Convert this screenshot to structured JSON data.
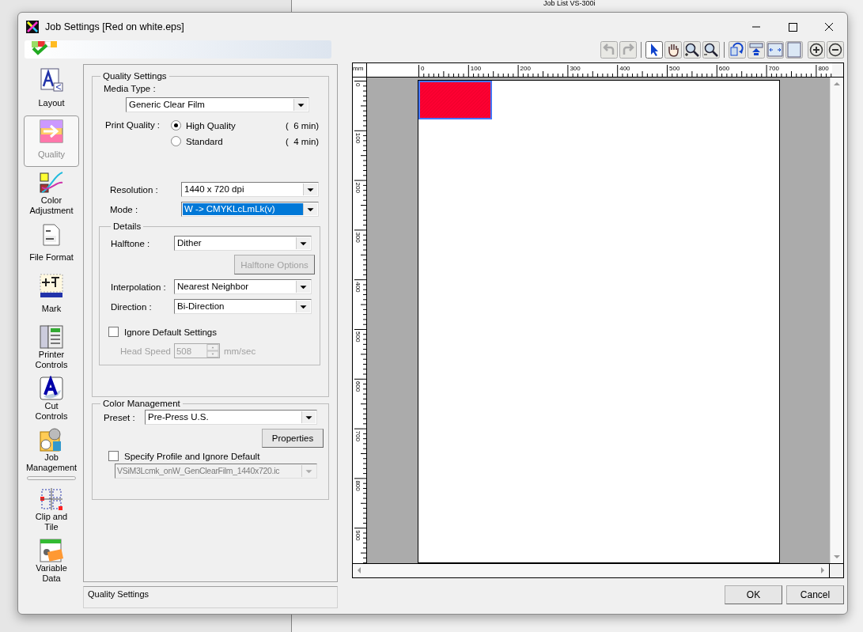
{
  "background": {
    "title": "Job List VS-300i"
  },
  "window": {
    "title": "Job Settings [Red on white.eps]"
  },
  "sidebar": {
    "items": [
      {
        "label": "Layout",
        "selected": false
      },
      {
        "label": "Quality",
        "selected": true
      },
      {
        "label": "Color Adjustment",
        "selected": false
      },
      {
        "label": "File Format",
        "selected": false
      },
      {
        "label": "Mark",
        "selected": false
      },
      {
        "label": "Printer Controls",
        "selected": false
      },
      {
        "label": "Cut Controls",
        "selected": false
      },
      {
        "label": "Job Management",
        "selected": false
      },
      {
        "label": "Clip and Tile",
        "selected": false
      },
      {
        "label": "Variable Data",
        "selected": false
      }
    ]
  },
  "quality_settings": {
    "title": "Quality Settings",
    "media_type": {
      "label": "Media Type :",
      "value": "Generic Clear Film"
    },
    "print_quality": {
      "label": "Print Quality :",
      "options": [
        {
          "label": "High Quality",
          "time": "(  6 min)",
          "selected": true
        },
        {
          "label": "Standard",
          "time": "(  4 min)",
          "selected": false
        }
      ]
    },
    "resolution": {
      "label": "Resolution :",
      "value": "1440 x 720 dpi"
    },
    "mode": {
      "label": "Mode :",
      "value": "W -> CMYKLcLmLk(v)",
      "highlighted": true
    },
    "details": {
      "title": "Details",
      "halftone": {
        "label": "Halftone :",
        "value": "Dither"
      },
      "halftone_options": {
        "label": "Halftone Options",
        "disabled": true
      },
      "interpolation": {
        "label": "Interpolation :",
        "value": "Nearest Neighbor"
      },
      "direction": {
        "label": "Direction :",
        "value": "Bi-Direction"
      },
      "ignore_default": {
        "label": "Ignore Default Settings",
        "checked": false
      },
      "head_speed": {
        "label": "Head Speed",
        "value": "508",
        "unit": "mm/sec",
        "disabled": true
      }
    }
  },
  "color_management": {
    "title": "Color Management",
    "preset": {
      "label": "Preset :",
      "value": "Pre-Press U.S."
    },
    "properties": {
      "label": "Properties"
    },
    "specify_profile": {
      "label": "Specify Profile and Ignore Default",
      "checked": false
    },
    "profile": {
      "value": "VSiM3Lcmk_onW_GenClearFilm_1440x720.ic",
      "disabled": true
    }
  },
  "status": "Quality Settings",
  "toolbar": [
    {
      "kind": "undo",
      "disabled": true
    },
    {
      "kind": "redo",
      "disabled": true
    },
    {
      "kind": "pointer",
      "selected": true
    },
    {
      "kind": "hand",
      "selected": false
    },
    {
      "kind": "zoom-in",
      "selected": false
    },
    {
      "kind": "zoom-out",
      "selected": false
    },
    {
      "kind": "rotate"
    },
    {
      "kind": "align"
    },
    {
      "kind": "fit-width"
    },
    {
      "kind": "page"
    },
    {
      "kind": "plus"
    },
    {
      "kind": "minus"
    }
  ],
  "preview": {
    "unit": "mm",
    "xticks": [
      "0",
      "100",
      "200",
      "300",
      "400",
      "500",
      "600",
      "700",
      "800"
    ],
    "yticks": [
      "0",
      "100",
      "200",
      "300",
      "400",
      "500",
      "600",
      "700",
      "800",
      "900"
    ]
  },
  "buttons": [
    "OK",
    "Cancel"
  ]
}
